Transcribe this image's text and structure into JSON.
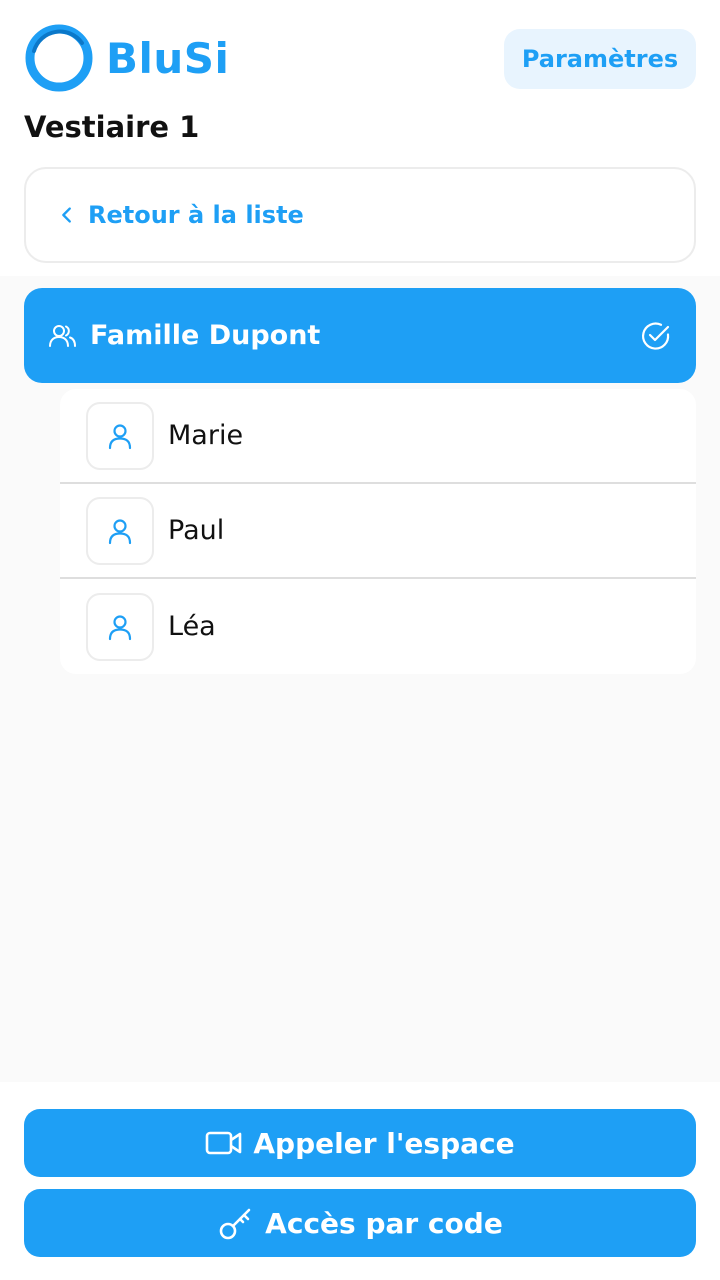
{
  "app": {
    "name": "BluSi",
    "brand_color": "#1e9ff5"
  },
  "header": {
    "settings_label": "Paramètres"
  },
  "page": {
    "title": "Vestiaire 1"
  },
  "back": {
    "label": "Retour à la liste"
  },
  "family": {
    "name": "Famille Dupont",
    "icon": "users-icon",
    "status_icon": "check-circle-icon"
  },
  "members": [
    {
      "name": "Marie",
      "icon": "user-icon"
    },
    {
      "name": "Paul",
      "icon": "user-icon"
    },
    {
      "name": "Léa",
      "icon": "user-icon"
    }
  ],
  "actions": {
    "call_label": "Appeler l'espace",
    "call_icon": "video-camera-icon",
    "code_label": "Accès par code",
    "code_icon": "key-icon"
  }
}
